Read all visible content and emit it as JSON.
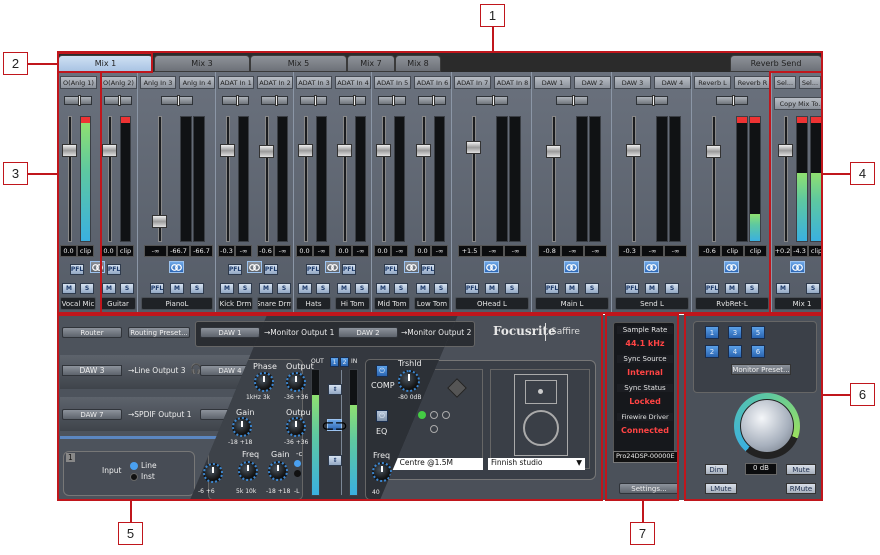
{
  "callouts": [
    "1",
    "2",
    "3",
    "4",
    "5",
    "6",
    "7"
  ],
  "tabs": [
    {
      "label": "Mix 1",
      "active": true
    },
    {
      "label": "Mix 3"
    },
    {
      "label": "Mix 5"
    },
    {
      "label": "Mix 7"
    },
    {
      "label": "Mix 8"
    },
    {
      "label": "Reverb Send"
    }
  ],
  "mixer": {
    "buttons": {
      "pfl": "PFL",
      "mute": "M",
      "solo": "S"
    },
    "groups": [
      {
        "type": "pair",
        "headers": [
          "O(Anlg 1)",
          "O(Anlg 2)"
        ],
        "linked": false,
        "channels": [
          {
            "name": "Vocal Mic",
            "readouts": [
              "0.0",
              "clip"
            ],
            "meter": 0.95,
            "clip": true,
            "fader": 0.75
          },
          {
            "name": "Guitar",
            "readouts": [
              "0.0",
              "clip"
            ],
            "meter": 0,
            "clip": true,
            "fader": 0.75
          }
        ]
      },
      {
        "type": "stereo",
        "headers": [
          "Anlg In 3",
          "Anlg In 4"
        ],
        "linked": true,
        "name": "PianoL",
        "readouts": [
          "-∞",
          "-66.7",
          "-66.7"
        ],
        "meters": [
          0,
          0
        ],
        "fader": 0.12
      },
      {
        "type": "pair",
        "headers": [
          "ADAT In 1",
          "ADAT In 2"
        ],
        "linked": false,
        "channels": [
          {
            "name": "Kick Drm",
            "readouts": [
              "-0.3",
              "-∞"
            ],
            "meter": 0,
            "fader": 0.75
          },
          {
            "name": "Snare Drm",
            "readouts": [
              "-0.6",
              "-∞"
            ],
            "meter": 0,
            "fader": 0.74
          }
        ]
      },
      {
        "type": "pair",
        "headers": [
          "ADAT In 3",
          "ADAT In 4"
        ],
        "linked": false,
        "channels": [
          {
            "name": "Hats",
            "readouts": [
              "0.0",
              "-∞"
            ],
            "meter": 0,
            "fader": 0.75
          },
          {
            "name": "Hi Tom",
            "readouts": [
              "0.0",
              "-∞"
            ],
            "meter": 0,
            "fader": 0.75
          }
        ]
      },
      {
        "type": "pair",
        "headers": [
          "ADAT In 5",
          "ADAT In 6"
        ],
        "linked": false,
        "channels": [
          {
            "name": "Mid Tom",
            "readouts": [
              "0.0",
              "-∞"
            ],
            "meter": 0,
            "fader": 0.75
          },
          {
            "name": "Low Tom",
            "readouts": [
              "0.0",
              "-∞"
            ],
            "meter": 0,
            "fader": 0.75
          }
        ]
      },
      {
        "type": "stereo",
        "headers": [
          "ADAT In 7",
          "ADAT In 8"
        ],
        "linked": true,
        "name": "OHead L",
        "readouts": [
          "+1.5",
          "-∞",
          "-∞"
        ],
        "meters": [
          0,
          0
        ],
        "fader": 0.78
      },
      {
        "type": "stereo",
        "headers": [
          "DAW 1",
          "DAW 2"
        ],
        "linked": true,
        "name": "Main L",
        "readouts": [
          "-0.8",
          "-∞",
          "-∞"
        ],
        "meters": [
          0,
          0
        ],
        "fader": 0.74
      },
      {
        "type": "stereo",
        "headers": [
          "DAW 3",
          "DAW 4"
        ],
        "linked": true,
        "name": "Send L",
        "readouts": [
          "-0.3",
          "-∞",
          "-∞"
        ],
        "meters": [
          0,
          0
        ],
        "fader": 0.75
      },
      {
        "type": "stereo",
        "headers": [
          "Reverb L",
          "Reverb R"
        ],
        "linked": true,
        "name": "RvbRet-L",
        "readouts": [
          "-0.6",
          "clip",
          "clip"
        ],
        "meters": [
          0,
          0.22
        ],
        "clip": true,
        "fader": 0.74
      },
      {
        "type": "mix",
        "headers": [
          "Sel...",
          "Sel..."
        ],
        "copy": "Copy Mix To...",
        "linked": true,
        "name": "Mix 1",
        "readouts": [
          "+0.2",
          "-4.3",
          "clip"
        ],
        "meters": [
          0.55,
          0.55
        ],
        "clip": true,
        "fader": 0.75
      }
    ]
  },
  "router": {
    "router_btn": "Router",
    "preset_btn": "Routing Preset...",
    "rows": [
      {
        "src": "DAW 1",
        "dest": "→Monitor Output 1"
      },
      {
        "src": "DAW 2",
        "dest": "→Monitor Output 2"
      },
      {
        "src": "DAW 3",
        "dest": "→Line Output 3"
      },
      {
        "src": "DAW 4"
      },
      {
        "src": "DAW 7",
        "dest": "→SPDIF Output 1"
      },
      {
        "src": "D"
      }
    ],
    "input": {
      "num": "1",
      "num2": "2",
      "label": "Input",
      "opt1": "Line",
      "opt2": "Inst"
    }
  },
  "logo": {
    "brand": "Focusrite",
    "product": "Saffire"
  },
  "plugin": {
    "knobs": [
      {
        "label": "Phase",
        "range": "1kHz 3k"
      },
      {
        "label": "Output",
        "range": "-36 +36"
      },
      {
        "label": "Gain",
        "range": "-18 +18"
      },
      {
        "label": "Output",
        "range": "-36 +36"
      },
      {
        "label": "",
        "range": "-6 +6"
      },
      {
        "label": "Freq",
        "range": "5k 10k"
      },
      {
        "label": "Gain",
        "range": "-18 +18"
      }
    ],
    "hp": {
      "label": "-c",
      "range": "-L"
    },
    "meter_out": "OUT",
    "meter_in": "IN",
    "ch1": "1",
    "ch2": "2",
    "out_level": 0.8,
    "in_level": 0.72,
    "comp": "COMP",
    "eq": "EQ",
    "thresh": {
      "label": "Trshld",
      "range": "-80 0dB"
    },
    "freq": {
      "label": "Freq",
      "range": "40"
    }
  },
  "speaker": {
    "position": "Centre @1.5M",
    "room": "Finnish studio"
  },
  "status": {
    "items": [
      {
        "label": "Sample Rate",
        "value": "44.1 kHz"
      },
      {
        "label": "Sync Source",
        "value": "Internal"
      },
      {
        "label": "Sync Status",
        "value": "Locked"
      },
      {
        "label": "Firewire Driver",
        "value": "Connected"
      }
    ],
    "device": "Pro24DSP-00000E",
    "settings": "Settings..."
  },
  "monitor": {
    "presets": [
      "1",
      "2",
      "3",
      "4",
      "5",
      "6"
    ],
    "preset_btn": "Monitor Preset...",
    "dim": "Dim",
    "level": "0 dB",
    "mute": "Mute",
    "lmute": "LMute",
    "rmute": "RMute"
  },
  "colors": {
    "accent": "#c0161c",
    "panel": "#59606b",
    "status_value": "#ff4444"
  }
}
